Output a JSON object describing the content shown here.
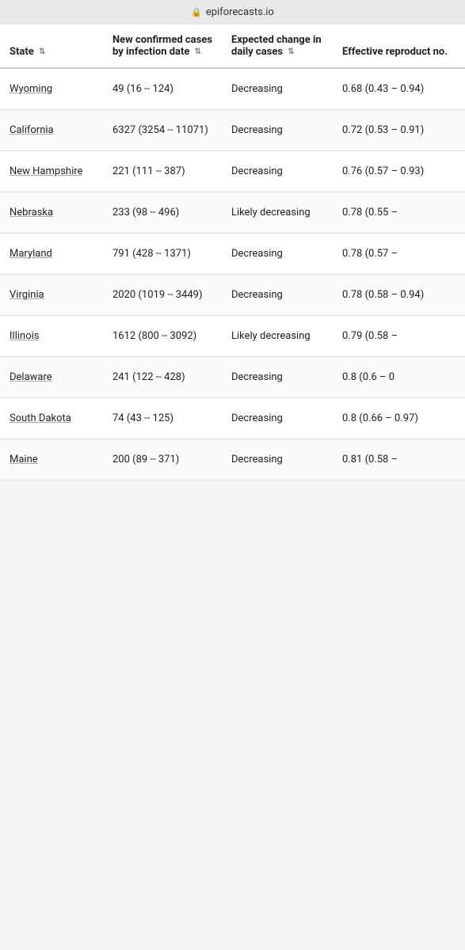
{
  "topbar": {
    "domain": "epiforecasts.io",
    "lock_label": "🔒"
  },
  "table": {
    "columns": [
      {
        "id": "state",
        "label": "State",
        "sortable": true
      },
      {
        "id": "cases",
        "label": "New confirmed cases by infection date",
        "sortable": true
      },
      {
        "id": "change",
        "label": "Expected change in daily cases",
        "sortable": true
      },
      {
        "id": "rt",
        "label": "Effective reproduct no.",
        "sortable": false
      }
    ],
    "rows": [
      {
        "state": "Wyoming",
        "cases": "49 (16 -- 124)",
        "change": "Decreasing",
        "rt": "0.68 (0.43 – 0.94)"
      },
      {
        "state": "California",
        "cases": "6327 (3254 -- 11071)",
        "change": "Decreasing",
        "rt": "0.72 (0.53 – 0.91)"
      },
      {
        "state": "New Hampshire",
        "cases": "221 (111 -- 387)",
        "change": "Decreasing",
        "rt": "0.76 (0.57 – 0.93)"
      },
      {
        "state": "Nebraska",
        "cases": "233 (98 -- 496)",
        "change": "Likely decreasing",
        "rt": "0.78 (0.55 –"
      },
      {
        "state": "Maryland",
        "cases": "791 (428 -- 1371)",
        "change": "Decreasing",
        "rt": "0.78 (0.57 –"
      },
      {
        "state": "Virginia",
        "cases": "2020 (1019 -- 3449)",
        "change": "Decreasing",
        "rt": "0.78 (0.58 – 0.94)"
      },
      {
        "state": "Illinois",
        "cases": "1612 (800 -- 3092)",
        "change": "Likely decreasing",
        "rt": "0.79 (0.58 –"
      },
      {
        "state": "Delaware",
        "cases": "241 (122 -- 428)",
        "change": "Decreasing",
        "rt": "0.8 (0.6 – 0"
      },
      {
        "state": "South Dakota",
        "cases": "74 (43 -- 125)",
        "change": "Decreasing",
        "rt": "0.8 (0.66 – 0.97)"
      },
      {
        "state": "Maine",
        "cases": "200 (89 -- 371)",
        "change": "Decreasing",
        "rt": "0.81 (0.58 –"
      }
    ]
  }
}
